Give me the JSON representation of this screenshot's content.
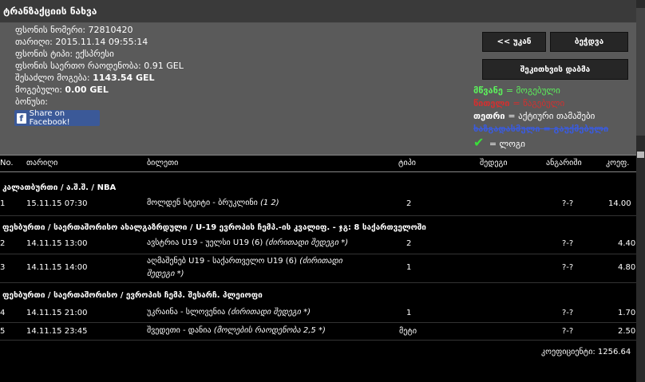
{
  "title": "ტრანზაქციის ნახვა",
  "info": {
    "ticket_number": "ფსონის ნომერი: 72810420",
    "date": "თარიღი: 2015.11.14 09:55:14",
    "type": "ფსონის ტიპი: ექსპრესი",
    "total_amount": "ფსონის საერთო რაოდენობა: 0.91 GEL",
    "possible_win_label": "შესაძლო მოგება:",
    "possible_win_value": "1143.54 GEL",
    "won_label": "მოგებული:",
    "won_value": "0.00 GEL",
    "bonus": "ბონუსი:"
  },
  "facebook_button": "Share on Facebook!",
  "buttons": {
    "back": "<< უკან",
    "save": "ბეჭდვა",
    "send": "შეკითხვის დაბმა"
  },
  "legend": {
    "green_label": "მწვანე",
    "green_text": "= მოგებული",
    "red_label": "წითელი",
    "red_text": "= წაგებული",
    "white_label": "თეთრი",
    "white_text": "= აქტიური თამაშები",
    "strike_text": "ხაზგადასმული = გაუქმებული",
    "check_text": "= ლოგი",
    "colors": {
      "green": "#5cf05c",
      "red": "#d23030",
      "white": "#ffffff",
      "blue": "#3b5bdb"
    }
  },
  "table": {
    "headers": [
      "No.",
      "თარიღი",
      "ბილეთი",
      "ტიპი",
      "შედეგი",
      "ანგარიში",
      "კოეფ."
    ],
    "groups": [
      {
        "category": "კალათბურთი / ა.შ.შ. / NBA",
        "rows": [
          {
            "no": "1",
            "date": "15.11.15 07:30",
            "event": "მოლდენ სტეიტი - ბრუკლინი",
            "event_italic": "(1 2)",
            "type": "2",
            "result": "",
            "score": "?-?",
            "coef": "14.00"
          }
        ]
      },
      {
        "category": "ფეხბურთი / საერთაშორისო ახალგაზრდული / U-19 ევროპის ჩემპ.-ის კვალიფ. - ჯგ: 8 საქართველოში",
        "rows": [
          {
            "no": "2",
            "date": "14.11.15 13:00",
            "event": "ავსტრია U19 - უელსი U19 (6)",
            "event_italic": "(ძირითადი შედეგი *)",
            "type": "2",
            "result": "",
            "score": "?-?",
            "coef": "4.40"
          },
          {
            "no": "3",
            "date": "14.11.15 14:00",
            "event": "აღმაშენებ U19 - საქართველო U19 (6)",
            "event_italic": "(ძირითადი შედეგი *)",
            "type": "1",
            "result": "",
            "score": "?-?",
            "coef": "4.80"
          }
        ]
      },
      {
        "category": "ფეხბურთი / საერთაშორისო / ევროპის ჩემპ. შესარჩ. პლეიოფი",
        "rows": [
          {
            "no": "4",
            "date": "14.11.15 21:00",
            "event": "უკრაინა - სლოვენია",
            "event_italic": "(ძირითადი შედეგი *)",
            "type": "1",
            "result": "",
            "score": "?-?",
            "coef": "1.70"
          },
          {
            "no": "5",
            "date": "14.11.15 23:45",
            "event": "შვედეთი - დანია",
            "event_italic": "(მოლების რაოდენობა 2,5 *)",
            "type": "მეტი",
            "result": "",
            "score": "?-?",
            "coef": "2.50"
          }
        ]
      }
    ],
    "total_coef": "კოეფიციენტი: 1256.64"
  }
}
